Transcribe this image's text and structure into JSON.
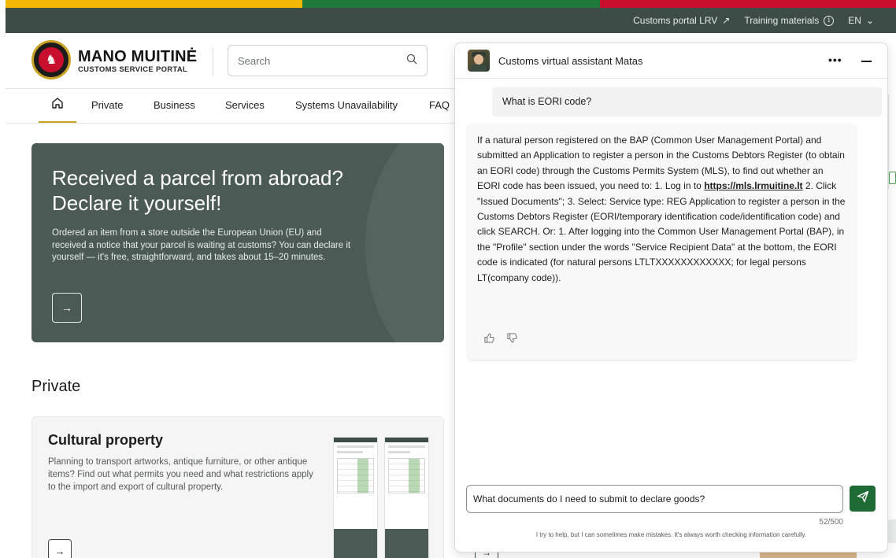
{
  "utility_bar": {
    "portal_link": "Customs portal LRV",
    "training_link": "Training materials",
    "language": "EN"
  },
  "header": {
    "logo_title": "MANO MUITINĖ",
    "logo_subtitle": "CUSTOMS SERVICE PORTAL",
    "search_placeholder": "Search"
  },
  "nav": {
    "items": [
      "Private",
      "Business",
      "Services",
      "Systems Unavailability",
      "FAQ"
    ]
  },
  "hero": {
    "title": "Received a parcel from abroad? Declare it yourself!",
    "description": "Ordered an item from a store outside the European Union (EU) and received a notice that your parcel is waiting at customs? You can declare it yourself — it's free, straightforward, and takes about 15–20 minutes.",
    "arrow": "→"
  },
  "section": {
    "title": "Private"
  },
  "card": {
    "title": "Cultural property",
    "description": "Planning to transport artworks, antique furniture, or other antique items? Find out what permits you need and what restrictions apply to the import and export of cultural property.",
    "arrow": "→"
  },
  "chat": {
    "title": "Customs virtual assistant Matas",
    "menu": "•••",
    "user_message": "What is EORI code?",
    "bot_message_part1": "If a natural person registered on the BAP (Common User Management Portal) and submitted an Application to register a person in the Customs Debtors Register (to obtain an EORI code) through the Customs Permits System (MLS), to find out whether an EORI code has been issued, you need to: 1. Log in to ",
    "bot_link": "https://mls.lrmuitine.lt",
    "bot_message_part2": " 2. Click \"Issued Documents\"; 3. Select: Service type: REG Application to register a person in the Customs Debtors Register (EORI/temporary identification code/identification code) and click SEARCH. Or: 1. After logging into the Common User Management Portal (BAP), in the \"Profile\" section under the words \"Service Recipient Data\" at the bottom, the EORI code is indicated (for natural persons LTLTXXXXXXXXXXXX; for legal persons LT(company code)).",
    "input_value": "What documents do I need to submit to declare goods?",
    "counter": "52/500",
    "disclaimer": "I try to help, but I can sometimes make mistakes. It's always worth checking information carefully."
  },
  "colors": {
    "utility_bg": "#3e4c47",
    "hero_bg": "#4c5a55",
    "send_button": "#1e6b35",
    "flag_yellow": "#f2b705",
    "flag_green": "#1e7a3b",
    "flag_red": "#c8102e"
  },
  "icons": {
    "external_link": "arrow-up-right-icon",
    "info": "info-icon",
    "chevron": "chevron-down-icon",
    "search": "search-icon",
    "home": "home-icon",
    "thumbs_up": "thumbs-up-icon",
    "thumbs_down": "thumbs-down-icon",
    "send": "send-icon"
  }
}
